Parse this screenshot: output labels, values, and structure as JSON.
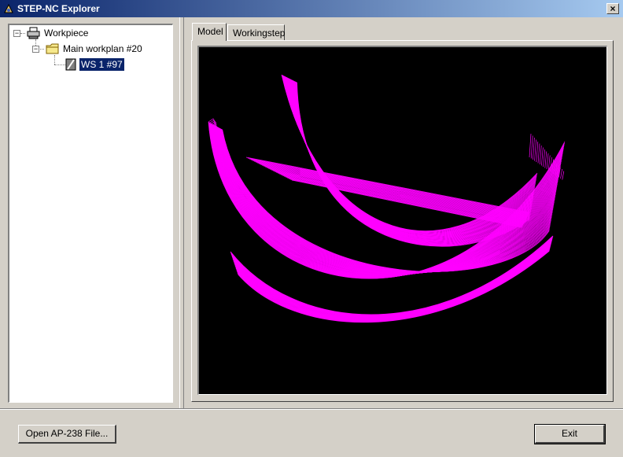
{
  "window": {
    "title": "STEP-NC Explorer",
    "close_label": "×"
  },
  "tree": {
    "items": [
      {
        "label": "Workpiece",
        "icon": "printer-workpiece-icon",
        "expander": "−"
      },
      {
        "label": "Main workplan #20",
        "icon": "folder-icon",
        "expander": "−"
      },
      {
        "label": "WS 1 #97",
        "icon": "workingstep-icon",
        "selected": true
      }
    ]
  },
  "tabs": [
    {
      "label": "Model",
      "active": true
    },
    {
      "label": "Workingstep",
      "active": false
    }
  ],
  "viewport": {
    "background": "#000000",
    "toolpath_color": "#ff00ff"
  },
  "buttons": {
    "open_label": "Open AP-238 File...",
    "exit_label": "Exit"
  }
}
